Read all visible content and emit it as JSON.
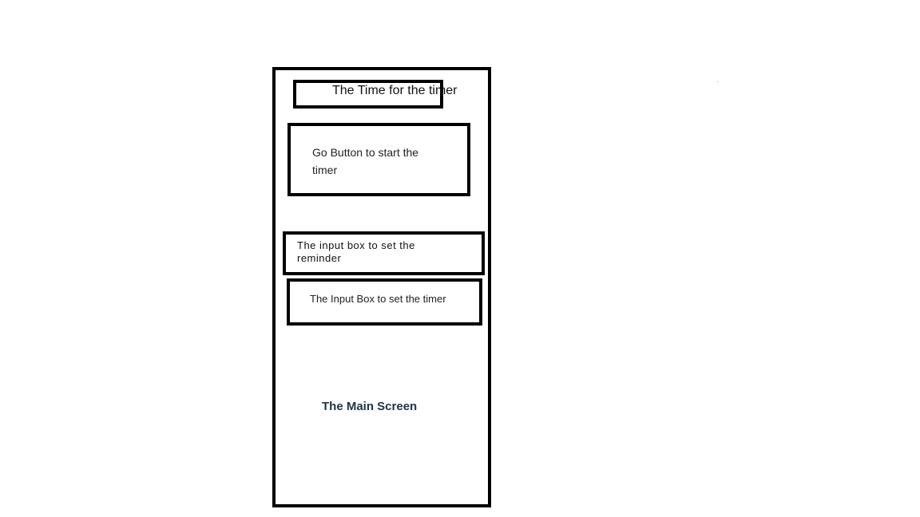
{
  "timer_display": {
    "label": "The Time for the timer"
  },
  "go_button": {
    "label": "Go Button to start the timer"
  },
  "reminder_input": {
    "label": "The input box to set the reminder"
  },
  "timer_input": {
    "label": "The Input Box to set the timer"
  },
  "main_screen": {
    "label": "The Main Screen"
  }
}
